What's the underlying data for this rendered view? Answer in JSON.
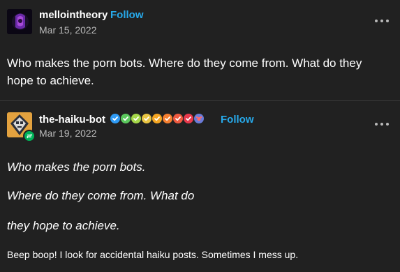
{
  "posts": [
    {
      "username": "mellointheory",
      "follow_label": "Follow",
      "date": "Mar 15, 2022",
      "body": "Who makes the porn bots. Where do they come from. What do they hope to achieve."
    },
    {
      "username": "the-haiku-bot",
      "follow_label": "Follow",
      "date": "Mar 19, 2022",
      "haiku": [
        "Who makes the porn bots.",
        "Where do they come from. What do",
        "they hope to achieve."
      ],
      "note": "Beep boop! I look for accidental haiku posts. Sometimes I mess up."
    }
  ],
  "badge_colors": [
    "#2f9bf5",
    "#5bc85d",
    "#a6d84a",
    "#e9c543",
    "#f5a623",
    "#f57f30",
    "#ef5a40",
    "#e8394c"
  ],
  "icons": {
    "more": "more-horizontal-icon",
    "verified": "check-badge-icon",
    "reblog": "reblog-icon"
  }
}
